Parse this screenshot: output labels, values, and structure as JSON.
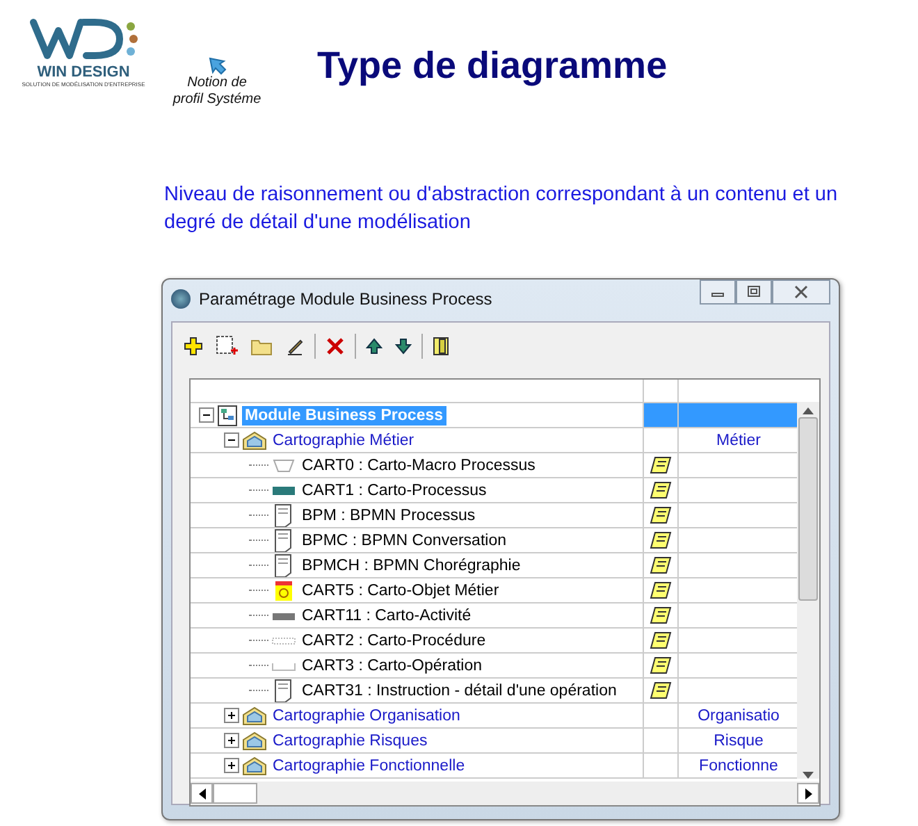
{
  "header": {
    "logo_text": "WIN DESIGN",
    "logo_tagline": "SOLUTION DE MODÉLISATION D'ENTREPRISE",
    "link": {
      "label": "Notion de profil Systéme"
    },
    "title": "Type de diagramme"
  },
  "description": "Niveau de raisonnement ou d'abstraction correspondant à un contenu et un degré de détail d'une modélisation",
  "window": {
    "title": "Paramétrage Module Business Process",
    "tree": [
      {
        "label": "Module Business Process",
        "kind": "module",
        "selected": true,
        "expanded": true,
        "children": [
          {
            "label": "Cartographie Métier",
            "kind": "category",
            "selected": false,
            "expanded": true,
            "column_3": "Métier",
            "children": [
              {
                "label": "CART0 : Carto-Macro Processus",
                "kind": "macro",
                "selected": false,
                "has_note": true
              },
              {
                "label": "CART1 : Carto-Processus",
                "kind": "process",
                "selected": false,
                "has_note": true
              },
              {
                "label": "BPM : BPMN Processus",
                "kind": "document",
                "selected": false,
                "has_note": true
              },
              {
                "label": "BPMC : BPMN Conversation",
                "kind": "document",
                "selected": false,
                "has_note": true
              },
              {
                "label": "BPMCH : BPMN Chorégraphie",
                "kind": "document",
                "selected": false,
                "has_note": true
              },
              {
                "label": "CART5 : Carto-Objet Métier",
                "kind": "object",
                "selected": false,
                "has_note": true
              },
              {
                "label": "CART11 : Carto-Activité",
                "kind": "activity",
                "selected": false,
                "has_note": true
              },
              {
                "label": "CART2 : Carto-Procédure",
                "kind": "procedure",
                "selected": false,
                "has_note": true
              },
              {
                "label": "CART3 : Carto-Opération",
                "kind": "operation",
                "selected": false,
                "has_note": true
              },
              {
                "label": "CART31 : Instruction - détail d'une opération",
                "kind": "document",
                "selected": false,
                "has_note": true
              }
            ]
          },
          {
            "label": "Cartographie Organisation",
            "kind": "category",
            "selected": false,
            "expanded": false,
            "column_3": "Organisatio"
          },
          {
            "label": "Cartographie Risques",
            "kind": "category",
            "selected": false,
            "expanded": false,
            "column_3": "Risque"
          },
          {
            "label": "Cartographie Fonctionnelle",
            "kind": "category",
            "selected": false,
            "expanded": false,
            "column_3": "Fonctionne"
          }
        ]
      }
    ]
  }
}
